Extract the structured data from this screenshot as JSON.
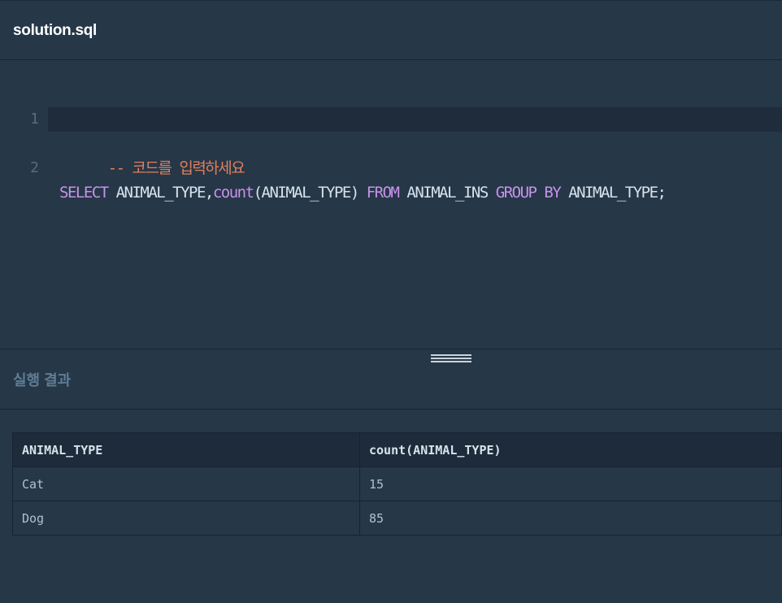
{
  "file": {
    "title": "solution.sql"
  },
  "editor": {
    "lines": [
      {
        "number": "1",
        "tokens": [
          {
            "type": "comment",
            "text": "-- 코드를 입력하세요"
          }
        ]
      },
      {
        "number": "2",
        "tokens": [
          {
            "type": "keyword",
            "text": "SELECT"
          },
          {
            "type": "plain",
            "text": " ANIMAL_TYPE,"
          },
          {
            "type": "func",
            "text": "count"
          },
          {
            "type": "plain",
            "text": "(ANIMAL_TYPE) "
          },
          {
            "type": "keyword",
            "text": "FROM"
          },
          {
            "type": "plain",
            "text": " ANIMAL_INS "
          },
          {
            "type": "keyword",
            "text": "GROUP BY"
          },
          {
            "type": "plain",
            "text": " ANIMAL_TYPE;"
          }
        ]
      }
    ]
  },
  "results": {
    "title": "실행 결과",
    "columns": [
      "ANIMAL_TYPE",
      "count(ANIMAL_TYPE)"
    ],
    "rows": [
      [
        "Cat",
        "15"
      ],
      [
        "Dog",
        "85"
      ]
    ]
  },
  "icons": {
    "drag_handle": "drag-handle-icon"
  },
  "colors": {
    "comment": "#e0805c",
    "keyword": "#c792ea",
    "background": "#263747"
  }
}
